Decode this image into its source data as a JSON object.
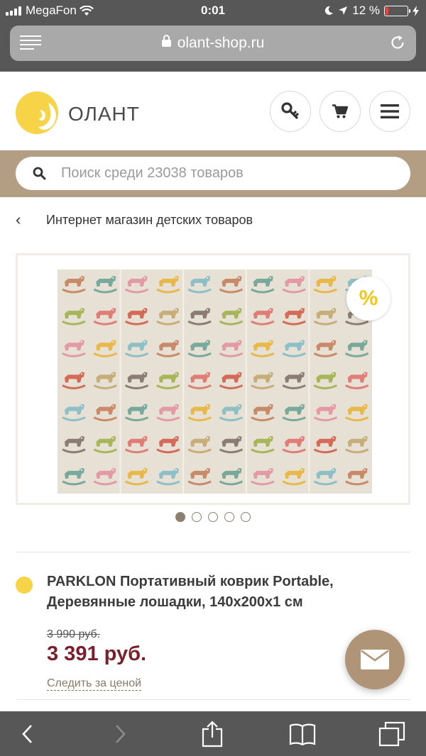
{
  "status_bar": {
    "carrier": "MegaFon",
    "time": "0:01",
    "battery_percent": "12 %",
    "battery_level": 0.12
  },
  "browser": {
    "url": "olant-shop.ru",
    "icons": [
      "reader-icon",
      "lock-icon",
      "reload-icon",
      "back-icon",
      "forward-icon",
      "share-icon",
      "bookmarks-icon",
      "tabs-icon"
    ]
  },
  "site": {
    "logo_text": "ОЛАНТ",
    "icons": [
      "key-icon",
      "cart-icon",
      "menu-icon"
    ]
  },
  "search": {
    "placeholder": "Поиск среди 23038 товаров"
  },
  "breadcrumb": {
    "back_symbol": "‹",
    "label": "Интернет магазин детских товаров"
  },
  "gallery": {
    "badge": "%",
    "slide_count": 5,
    "active_slide": 1
  },
  "product": {
    "title": "PARKLON Портативный коврик Portable, Деревянные лошадки, 140x200x1 см",
    "old_price": "3 990 руб.",
    "price": "3 391 руб.",
    "follow_label": "Следить за ценой"
  },
  "colors": {
    "brand_yellow": "#f7d348",
    "brand_brown": "#b39e84",
    "price_red": "#7a1f2b",
    "browser_chrome": "#575757"
  }
}
